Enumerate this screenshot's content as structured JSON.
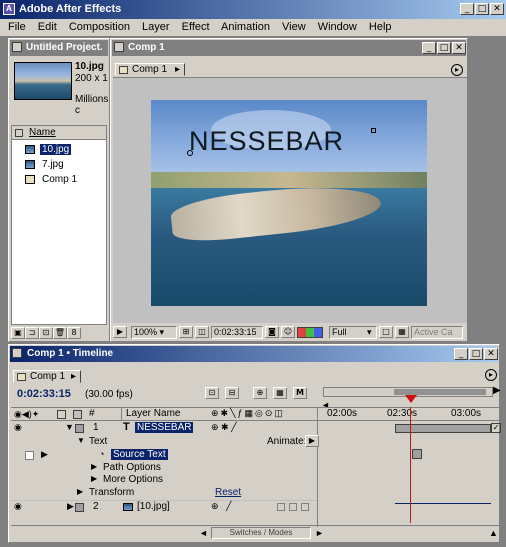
{
  "app": {
    "title": "Adobe After Effects"
  },
  "menu": [
    "File",
    "Edit",
    "Composition",
    "Layer",
    "Effect",
    "Animation",
    "View",
    "Window",
    "Help"
  ],
  "project": {
    "title": "Untitled Project.",
    "preview_name": "10.jpg",
    "preview_dims": "200 x 1",
    "preview_colors": "Millions c",
    "column_name": "Name",
    "items": [
      "10.jpg",
      "7.jpg",
      "Comp 1"
    ]
  },
  "comp": {
    "title": "Comp 1",
    "tab": "Comp 1",
    "overlay_text": "NESSEBAR",
    "zoom": "100%",
    "timecode": "0:02:33:15",
    "resolution": "Full",
    "active_camera": "Active Ca"
  },
  "timeline": {
    "title": "Comp 1 • Timeline",
    "tab": "Comp 1",
    "timecode": "0:02:33:15",
    "fps": "(30.00 fps)",
    "col_layer_name": "Layer Name",
    "ruler": [
      "02:00s",
      "02:30s",
      "03:00s"
    ],
    "layers": [
      {
        "num": "1",
        "name": "NESSEBAR"
      },
      {
        "num": "2",
        "name": "[10.jpg]"
      }
    ],
    "text_group": "Text",
    "animate": "Animate:",
    "source_text": "Source Text",
    "path_options": "Path Options",
    "more_options": "More Options",
    "transform": "Transform",
    "reset": "Reset",
    "switches": "Switches / Modes"
  },
  "colors": {
    "titlebar_a": "#0a246a",
    "titlebar_b": "#a6caf0",
    "playhead": "#d01010",
    "selected": "#0a246a"
  }
}
